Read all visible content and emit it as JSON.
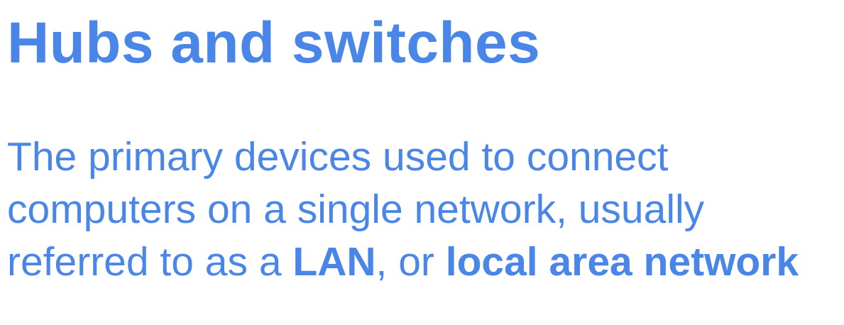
{
  "slide": {
    "title": "Hubs and switches",
    "body": {
      "line1": "The primary devices used to connect",
      "line2": "computers on a single network, usually",
      "line3_prefix": "referred to as a ",
      "line3_term1": "LAN",
      "line3_mid": ", or ",
      "line3_term2": "local area network"
    },
    "colors": {
      "text": "#4a86e8",
      "background": "#ffffff"
    }
  }
}
